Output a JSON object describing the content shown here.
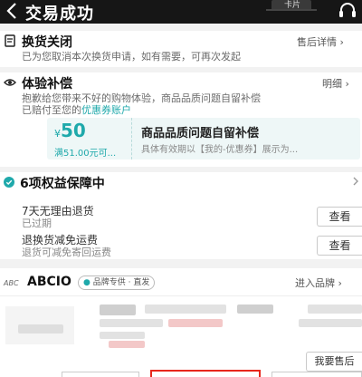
{
  "header": {
    "title": "交易成功",
    "badge_text": "卡片"
  },
  "exchange": {
    "title": "换货关闭",
    "link": "售后详情 ›",
    "subtitle": "已为您取消本次换货申请，如有需要，可再次发起"
  },
  "compensation": {
    "title": "体验补偿",
    "link": "明细 ›",
    "desc_line1": "抱歉给您带来不好的购物体验，商品品质问题自留补偿",
    "desc_line2_prefix": "已赔付至您的",
    "desc_line2_link": "优惠券账户",
    "coupon": {
      "currency": "¥",
      "amount": "50",
      "condition": "满51.00元可...",
      "title": "商品品质问题自留补偿",
      "desc": "具体有效期以【我的-优惠券】展示为..."
    }
  },
  "guarantee": {
    "title": "6项权益保障中",
    "rows": [
      {
        "title": "7天无理由退货",
        "sub": "已过期",
        "button": "查看"
      },
      {
        "title": "退换货减免运费",
        "sub": "退货可减免寄回运费",
        "button": "查看"
      }
    ]
  },
  "shop": {
    "logo_text": "ABC",
    "name": "ABCIO",
    "tag": "品牌专供 · 直发",
    "link": "进入品牌 ›",
    "aftersale_button": "我要售后"
  },
  "colors": {
    "accent": "#1fa9ab",
    "header_bg": "#161616",
    "highlight": "#e8271c"
  }
}
